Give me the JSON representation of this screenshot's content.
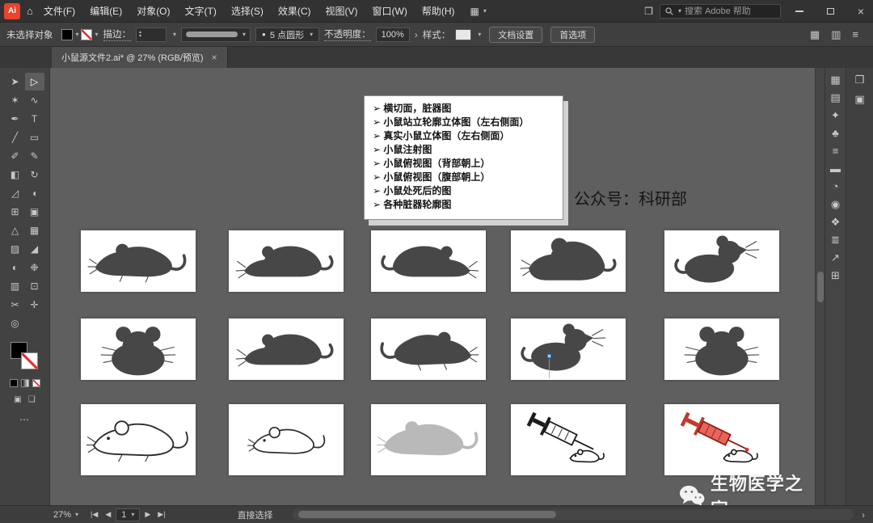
{
  "colors": {
    "accent_red": "#e8442c",
    "selection_blue": "#2b7fd4",
    "syringe_red": "#e05a52",
    "mouse_dark": "#474747",
    "mouse_light": "#b9b9b9"
  },
  "icons": {
    "home": "⌂",
    "chevron_down": "▾",
    "arrange": "❒",
    "grid": "▦",
    "dock": "▥",
    "menu": "≡",
    "expand": "›",
    "bullet_dot": "●",
    "draw_normal": "▣",
    "screen_mode": "❏",
    "close": "×"
  },
  "titlebar": {
    "app_name": "Ai",
    "menus": [
      "文件(F)",
      "编辑(E)",
      "对象(O)",
      "文字(T)",
      "选择(S)",
      "效果(C)",
      "视图(V)",
      "窗口(W)",
      "帮助(H)"
    ],
    "search_placeholder": "搜索 Adobe 帮助"
  },
  "control_bar": {
    "selection_status": "未选择对象",
    "stroke_label": "描边：",
    "brush_name": "5 点圆形",
    "opacity_label": "不透明度：",
    "opacity_value": "100%",
    "style_label": "样式：",
    "document_setup": "文档设置",
    "preferences": "首选项"
  },
  "document_tab": {
    "title": "小鼠源文件2.ai* @ 27% (RGB/预览)",
    "close": "×"
  },
  "toolbar": {
    "overflow": "⋯",
    "tools": [
      {
        "name": "selection",
        "glyph": "➤"
      },
      {
        "name": "direct-selection",
        "glyph": "▷",
        "active": true
      },
      {
        "name": "magic-wand",
        "glyph": "✶"
      },
      {
        "name": "lasso",
        "glyph": "∿"
      },
      {
        "name": "pen",
        "glyph": "✒"
      },
      {
        "name": "type",
        "glyph": "T"
      },
      {
        "name": "line-segment",
        "glyph": "╱"
      },
      {
        "name": "rectangle",
        "glyph": "▭"
      },
      {
        "name": "paintbrush",
        "glyph": "✐"
      },
      {
        "name": "pencil",
        "glyph": "✎"
      },
      {
        "name": "eraser",
        "glyph": "◧"
      },
      {
        "name": "rotate",
        "glyph": "↻"
      },
      {
        "name": "scale",
        "glyph": "◿"
      },
      {
        "name": "width",
        "glyph": "◖"
      },
      {
        "name": "free-transform",
        "glyph": "⊞"
      },
      {
        "name": "shape-builder",
        "glyph": "▣"
      },
      {
        "name": "perspective-grid",
        "glyph": "△"
      },
      {
        "name": "mesh",
        "glyph": "▦"
      },
      {
        "name": "gradient",
        "glyph": "▨"
      },
      {
        "name": "eyedropper",
        "glyph": "◢"
      },
      {
        "name": "blend",
        "glyph": "◐"
      },
      {
        "name": "symbol-sprayer",
        "glyph": "❉"
      },
      {
        "name": "column-graph",
        "glyph": "▥"
      },
      {
        "name": "artboard",
        "glyph": "⊡"
      },
      {
        "name": "slice",
        "glyph": "✂"
      },
      {
        "name": "hand",
        "glyph": "✛"
      },
      {
        "name": "zoom",
        "glyph": "◎"
      }
    ]
  },
  "right_dock": {
    "panels": [
      {
        "name": "swatches",
        "glyph": "▦"
      },
      {
        "name": "color",
        "glyph": "▤"
      },
      {
        "name": "color-guide",
        "glyph": "✦"
      },
      {
        "name": "symbols",
        "glyph": "♣"
      },
      {
        "name": "stroke",
        "glyph": "≡"
      },
      {
        "name": "brushes",
        "glyph": "▬"
      },
      {
        "name": "transparency",
        "glyph": "◔"
      },
      {
        "name": "appearance",
        "glyph": "◉"
      },
      {
        "name": "graphic-styles",
        "glyph": "❖"
      },
      {
        "name": "layers",
        "glyph": "≣"
      },
      {
        "name": "asset-export",
        "glyph": "↗"
      },
      {
        "name": "artboards",
        "glyph": "⊞"
      }
    ],
    "outer": [
      {
        "name": "properties",
        "glyph": "❒"
      },
      {
        "name": "libraries",
        "glyph": "▣"
      }
    ]
  },
  "canvas": {
    "note_panel": {
      "bullet": "➢",
      "items": [
        "横切面，脏器图",
        "小鼠站立轮廓立体图（左右侧面）",
        "真实小鼠立体图（左右侧面）",
        "小鼠注射图",
        "小鼠俯视图（背部朝上）",
        "小鼠俯视图（腹部朝上）",
        "小鼠处死后的图",
        "各种脏器轮廓图"
      ]
    },
    "annotation_text": "公众号：科研部",
    "watermark_text": "生物医学之家",
    "artboards": [
      {
        "variant": "side"
      },
      {
        "variant": "hunched"
      },
      {
        "variant": "hunched",
        "flip": true
      },
      {
        "variant": "round"
      },
      {
        "variant": "alert"
      },
      {
        "variant": "front"
      },
      {
        "variant": "hunched"
      },
      {
        "variant": "side",
        "flip": true
      },
      {
        "variant": "alert",
        "selected": true
      },
      {
        "variant": "front"
      },
      {
        "variant": "outline"
      },
      {
        "variant": "outline-small"
      },
      {
        "variant": "light"
      },
      {
        "variant": "syringe-black"
      },
      {
        "variant": "syringe-red"
      }
    ]
  },
  "status_bar": {
    "zoom": "27%",
    "nav": {
      "first": "|◀",
      "prev": "◀",
      "page": "1",
      "next": "▶",
      "last": "▶|"
    },
    "tool_hint": "直接选择"
  }
}
